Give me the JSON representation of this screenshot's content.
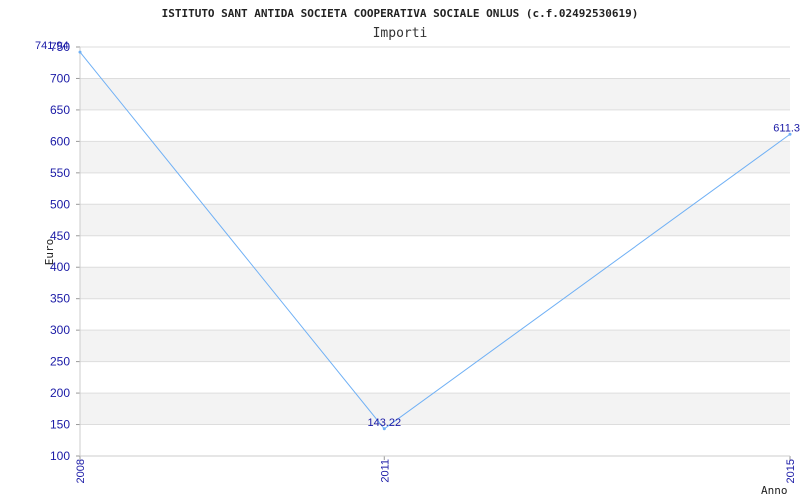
{
  "chart_data": {
    "type": "line",
    "title": "ISTITUTO SANT ANTIDA SOCIETA COOPERATIVA SOCIALE ONLUS (c.f.02492530619)",
    "subtitle": "Importi",
    "xlabel": "Anno",
    "ylabel": "Euro",
    "x": [
      "2008",
      "2011",
      "2015"
    ],
    "series": [
      {
        "values": [
          741.94,
          143.22,
          611.3
        ],
        "labels": [
          "741.94",
          "143.22",
          "611.3"
        ]
      }
    ],
    "ylim": [
      100,
      750
    ],
    "yticks": [
      100,
      150,
      200,
      250,
      300,
      350,
      400,
      450,
      500,
      550,
      600,
      650,
      700,
      750
    ],
    "grid": true,
    "colors": {
      "line": "#6fb0f5",
      "band": "#f3f3f3",
      "grid": "#dddddd",
      "tick_text": "#1a1aa6"
    }
  }
}
